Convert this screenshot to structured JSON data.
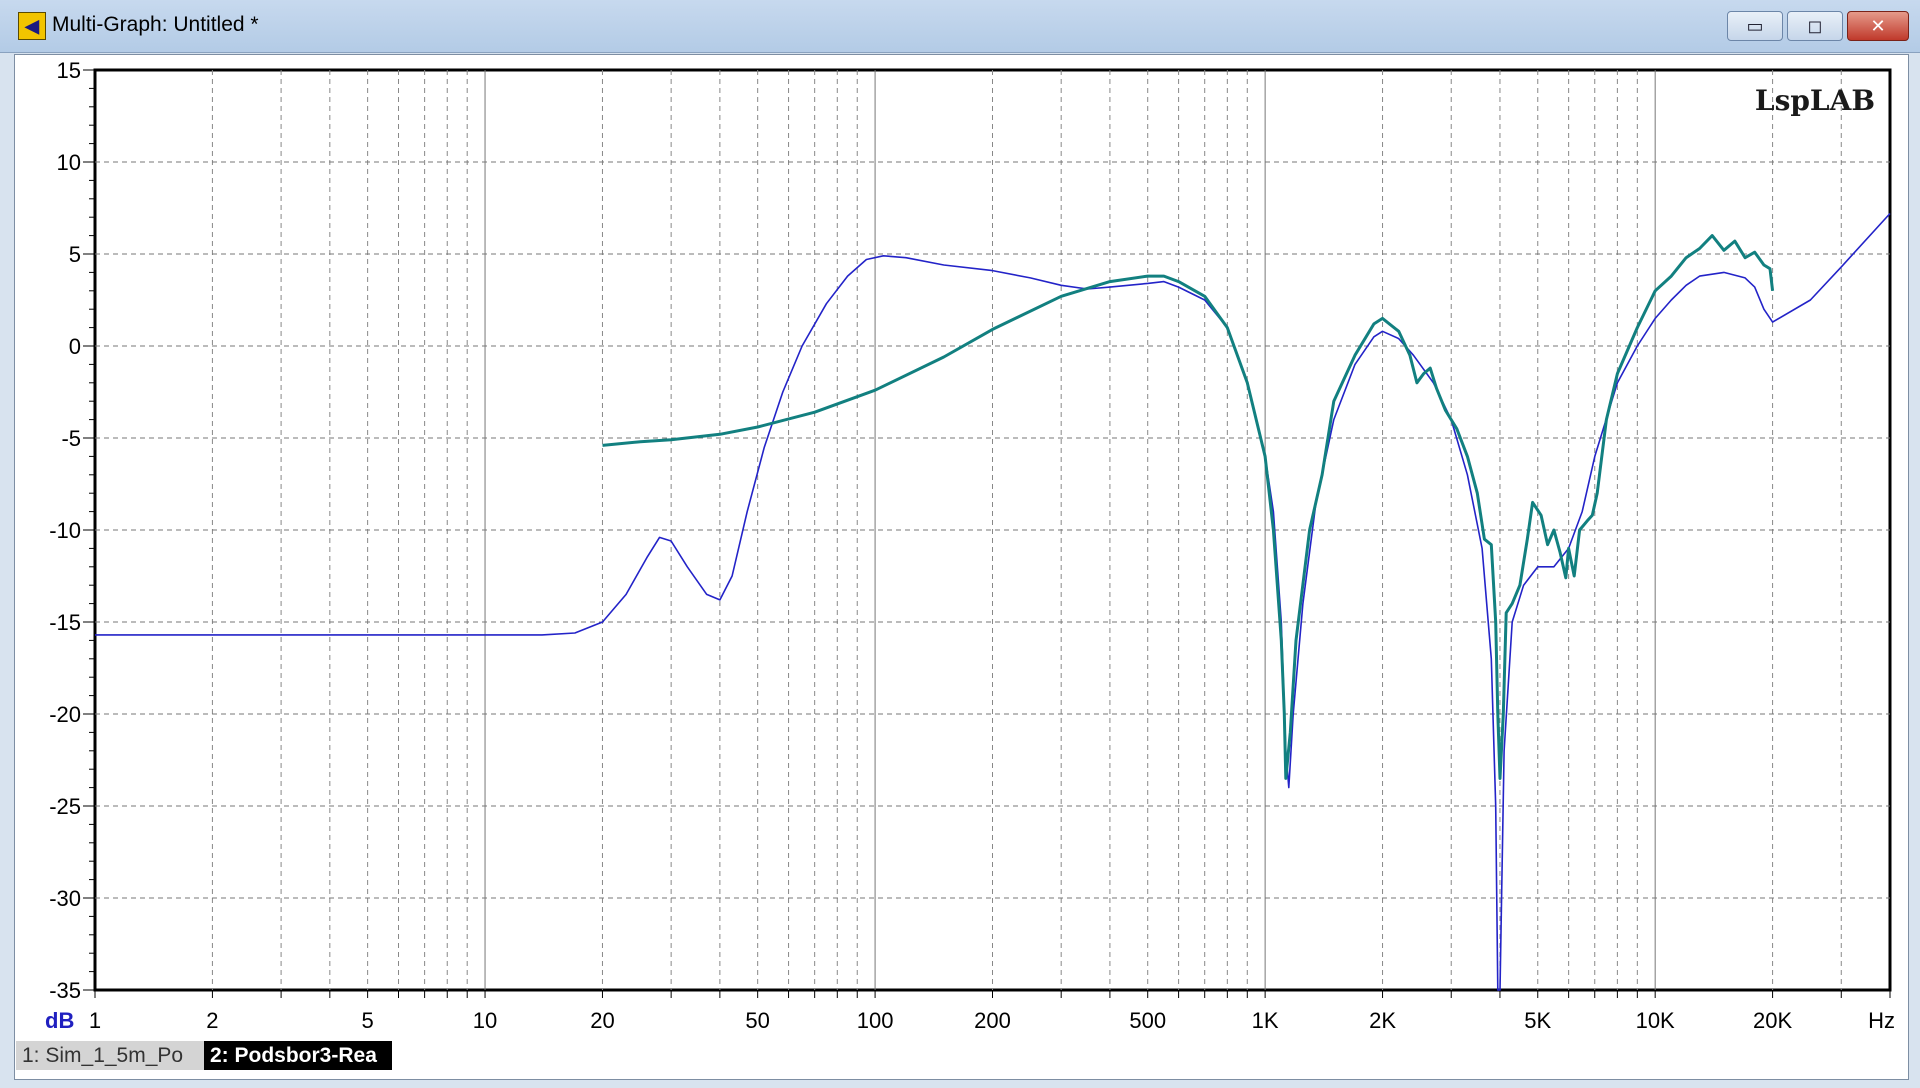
{
  "window": {
    "title": "Multi-Graph: Untitled *",
    "buttons": {
      "minimize": "▭",
      "maximize": "◻",
      "close": "✕"
    }
  },
  "tabs": [
    {
      "label": "1: Sim_1_5m_Po",
      "active": false
    },
    {
      "label": "2: Podsbor3-Rea",
      "active": true
    }
  ],
  "chart_data": {
    "type": "line",
    "watermark": "LspLAB",
    "xlabel": "Hz",
    "ylabel": "dB",
    "xscale": "log",
    "xlim": [
      1,
      40000
    ],
    "ylim": [
      -35,
      15
    ],
    "grid": true,
    "x_ticks": [
      {
        "value": 1,
        "label": "1"
      },
      {
        "value": 2,
        "label": "2"
      },
      {
        "value": 5,
        "label": "5"
      },
      {
        "value": 10,
        "label": "10"
      },
      {
        "value": 20,
        "label": "20"
      },
      {
        "value": 50,
        "label": "50"
      },
      {
        "value": 100,
        "label": "100"
      },
      {
        "value": 200,
        "label": "200"
      },
      {
        "value": 500,
        "label": "500"
      },
      {
        "value": 1000,
        "label": "1K"
      },
      {
        "value": 2000,
        "label": "2K"
      },
      {
        "value": 5000,
        "label": "5K"
      },
      {
        "value": 10000,
        "label": "10K"
      },
      {
        "value": 20000,
        "label": "20K"
      }
    ],
    "y_ticks": [
      {
        "value": 15,
        "label": "15"
      },
      {
        "value": 10,
        "label": "10"
      },
      {
        "value": 5,
        "label": "5"
      },
      {
        "value": 0,
        "label": "0"
      },
      {
        "value": -5,
        "label": "-5"
      },
      {
        "value": -10,
        "label": "-10"
      },
      {
        "value": -15,
        "label": "-15"
      },
      {
        "value": -20,
        "label": "-20"
      },
      {
        "value": -25,
        "label": "-25"
      },
      {
        "value": -30,
        "label": "-30"
      },
      {
        "value": -35,
        "label": "-35"
      }
    ],
    "series": [
      {
        "color": "#2323c8",
        "width": 1.6,
        "points": [
          [
            1,
            -15.7
          ],
          [
            5,
            -15.7
          ],
          [
            10,
            -15.7
          ],
          [
            14,
            -15.7
          ],
          [
            17,
            -15.6
          ],
          [
            20,
            -15
          ],
          [
            23,
            -13.5
          ],
          [
            26,
            -11.5
          ],
          [
            28,
            -10.4
          ],
          [
            30,
            -10.6
          ],
          [
            33,
            -12
          ],
          [
            37,
            -13.5
          ],
          [
            40,
            -13.8
          ],
          [
            43,
            -12.5
          ],
          [
            47,
            -9
          ],
          [
            52,
            -5.5
          ],
          [
            58,
            -2.5
          ],
          [
            65,
            0
          ],
          [
            75,
            2.3
          ],
          [
            85,
            3.8
          ],
          [
            95,
            4.7
          ],
          [
            105,
            4.9
          ],
          [
            120,
            4.8
          ],
          [
            150,
            4.4
          ],
          [
            200,
            4.1
          ],
          [
            250,
            3.7
          ],
          [
            300,
            3.3
          ],
          [
            350,
            3.1
          ],
          [
            400,
            3.2
          ],
          [
            500,
            3.4
          ],
          [
            550,
            3.5
          ],
          [
            600,
            3.2
          ],
          [
            700,
            2.5
          ],
          [
            800,
            1
          ],
          [
            900,
            -2
          ],
          [
            1000,
            -6
          ],
          [
            1050,
            -9
          ],
          [
            1100,
            -15
          ],
          [
            1130,
            -22
          ],
          [
            1150,
            -24
          ],
          [
            1180,
            -20
          ],
          [
            1250,
            -14
          ],
          [
            1350,
            -8.5
          ],
          [
            1500,
            -4
          ],
          [
            1700,
            -1
          ],
          [
            1900,
            0.5
          ],
          [
            2000,
            0.8
          ],
          [
            2200,
            0.4
          ],
          [
            2400,
            -0.5
          ],
          [
            2700,
            -2
          ],
          [
            3000,
            -4
          ],
          [
            3300,
            -7
          ],
          [
            3600,
            -11
          ],
          [
            3800,
            -17
          ],
          [
            3900,
            -25
          ],
          [
            3950,
            -35
          ],
          [
            4000,
            -35
          ],
          [
            4100,
            -22
          ],
          [
            4300,
            -15
          ],
          [
            4600,
            -13
          ],
          [
            5000,
            -12
          ],
          [
            5500,
            -12
          ],
          [
            6000,
            -11
          ],
          [
            6500,
            -9
          ],
          [
            7000,
            -6
          ],
          [
            8000,
            -2
          ],
          [
            9000,
            0
          ],
          [
            10000,
            1.5
          ],
          [
            11000,
            2.5
          ],
          [
            12000,
            3.3
          ],
          [
            13000,
            3.8
          ],
          [
            15000,
            4
          ],
          [
            17000,
            3.7
          ],
          [
            18000,
            3.2
          ],
          [
            19000,
            2
          ],
          [
            20000,
            1.3
          ],
          [
            25000,
            2.5
          ],
          [
            30000,
            4.3
          ],
          [
            40000,
            7.2
          ]
        ]
      },
      {
        "color": "#128080",
        "width": 3,
        "points": [
          [
            20,
            -5.4
          ],
          [
            25,
            -5.2
          ],
          [
            30,
            -5.1
          ],
          [
            40,
            -4.8
          ],
          [
            50,
            -4.4
          ],
          [
            70,
            -3.6
          ],
          [
            100,
            -2.4
          ],
          [
            150,
            -0.6
          ],
          [
            200,
            0.9
          ],
          [
            300,
            2.7
          ],
          [
            400,
            3.5
          ],
          [
            500,
            3.8
          ],
          [
            550,
            3.8
          ],
          [
            600,
            3.5
          ],
          [
            700,
            2.7
          ],
          [
            800,
            1
          ],
          [
            900,
            -2
          ],
          [
            1000,
            -6
          ],
          [
            1050,
            -10
          ],
          [
            1100,
            -16
          ],
          [
            1120,
            -20
          ],
          [
            1130,
            -23.5
          ],
          [
            1160,
            -21
          ],
          [
            1200,
            -16
          ],
          [
            1300,
            -10
          ],
          [
            1400,
            -7
          ],
          [
            1500,
            -3
          ],
          [
            1700,
            -0.5
          ],
          [
            1900,
            1.2
          ],
          [
            2000,
            1.5
          ],
          [
            2200,
            0.8
          ],
          [
            2350,
            -0.5
          ],
          [
            2450,
            -2
          ],
          [
            2550,
            -1.5
          ],
          [
            2650,
            -1.2
          ],
          [
            2750,
            -2.3
          ],
          [
            2900,
            -3.5
          ],
          [
            3100,
            -4.5
          ],
          [
            3300,
            -6
          ],
          [
            3500,
            -8
          ],
          [
            3650,
            -10.5
          ],
          [
            3800,
            -10.8
          ],
          [
            3900,
            -15
          ],
          [
            3950,
            -20
          ],
          [
            4000,
            -23.5
          ],
          [
            4080,
            -20
          ],
          [
            4150,
            -14.5
          ],
          [
            4300,
            -14
          ],
          [
            4500,
            -13
          ],
          [
            4700,
            -10.5
          ],
          [
            4850,
            -8.5
          ],
          [
            5100,
            -9.2
          ],
          [
            5300,
            -10.8
          ],
          [
            5500,
            -10
          ],
          [
            5700,
            -11.2
          ],
          [
            5900,
            -12.6
          ],
          [
            6000,
            -11
          ],
          [
            6200,
            -12.5
          ],
          [
            6400,
            -10
          ],
          [
            6700,
            -9.5
          ],
          [
            6900,
            -9.2
          ],
          [
            7100,
            -8
          ],
          [
            7500,
            -4
          ],
          [
            8000,
            -1.5
          ],
          [
            9000,
            1
          ],
          [
            10000,
            3
          ],
          [
            11000,
            3.8
          ],
          [
            12000,
            4.8
          ],
          [
            13000,
            5.3
          ],
          [
            14000,
            6
          ],
          [
            15000,
            5.2
          ],
          [
            16000,
            5.7
          ],
          [
            17000,
            4.8
          ],
          [
            18000,
            5.1
          ],
          [
            19000,
            4.4
          ],
          [
            19700,
            4.2
          ],
          [
            20000,
            3
          ]
        ]
      }
    ]
  }
}
